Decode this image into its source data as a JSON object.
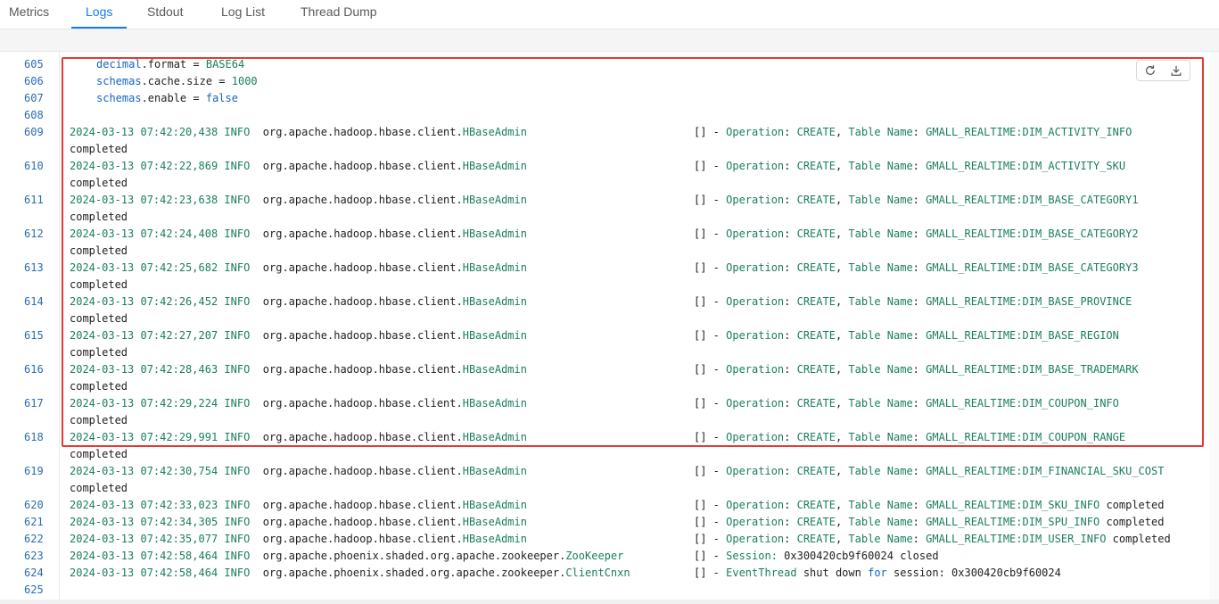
{
  "tabs": [
    {
      "label": "Metrics"
    },
    {
      "label": "Logs"
    },
    {
      "label": "Stdout"
    },
    {
      "label": "Log List"
    },
    {
      "label": "Thread Dump"
    }
  ],
  "toolbar": {
    "refresh_icon": "refresh-icon",
    "download_icon": "download-icon"
  },
  "colors": {
    "accent": "#1677ff",
    "highlight_border": "#e53935",
    "log_green": "#1a7f5a",
    "line_number": "#2b6cb0"
  },
  "config_lines": [
    {
      "num": "605",
      "obj": "decimal",
      "prop": ".format",
      "eq": " = ",
      "val": "BASE64"
    },
    {
      "num": "606",
      "obj": "schemas",
      "prop": ".cache.size",
      "eq": " = ",
      "val": "1000"
    },
    {
      "num": "607",
      "obj": "schemas",
      "prop": ".enable",
      "eq": " = ",
      "val": "false"
    }
  ],
  "blank_line": "608",
  "log_lines": [
    {
      "num": "609",
      "ts": "2024-03-13 07:42:20,438",
      "level": "INFO",
      "pkg": "org.apache.hadoop.hbase.client.",
      "cls": "HBaseAdmin",
      "table": "GMALL_REALTIME:DIM_ACTIVITY_INFO",
      "tail": "completed"
    },
    {
      "num": "610",
      "ts": "2024-03-13 07:42:22,869",
      "level": "INFO",
      "pkg": "org.apache.hadoop.hbase.client.",
      "cls": "HBaseAdmin",
      "table": "GMALL_REALTIME:DIM_ACTIVITY_SKU",
      "tail": "completed"
    },
    {
      "num": "611",
      "ts": "2024-03-13 07:42:23,638",
      "level": "INFO",
      "pkg": "org.apache.hadoop.hbase.client.",
      "cls": "HBaseAdmin",
      "table": "GMALL_REALTIME:DIM_BASE_CATEGORY1",
      "tail": "completed"
    },
    {
      "num": "612",
      "ts": "2024-03-13 07:42:24,408",
      "level": "INFO",
      "pkg": "org.apache.hadoop.hbase.client.",
      "cls": "HBaseAdmin",
      "table": "GMALL_REALTIME:DIM_BASE_CATEGORY2",
      "tail": "completed"
    },
    {
      "num": "613",
      "ts": "2024-03-13 07:42:25,682",
      "level": "INFO",
      "pkg": "org.apache.hadoop.hbase.client.",
      "cls": "HBaseAdmin",
      "table": "GMALL_REALTIME:DIM_BASE_CATEGORY3",
      "tail": "completed"
    },
    {
      "num": "614",
      "ts": "2024-03-13 07:42:26,452",
      "level": "INFO",
      "pkg": "org.apache.hadoop.hbase.client.",
      "cls": "HBaseAdmin",
      "table": "GMALL_REALTIME:DIM_BASE_PROVINCE",
      "tail": "completed"
    },
    {
      "num": "615",
      "ts": "2024-03-13 07:42:27,207",
      "level": "INFO",
      "pkg": "org.apache.hadoop.hbase.client.",
      "cls": "HBaseAdmin",
      "table": "GMALL_REALTIME:DIM_BASE_REGION",
      "tail": "completed"
    },
    {
      "num": "616",
      "ts": "2024-03-13 07:42:28,463",
      "level": "INFO",
      "pkg": "org.apache.hadoop.hbase.client.",
      "cls": "HBaseAdmin",
      "table": "GMALL_REALTIME:DIM_BASE_TRADEMARK",
      "tail": "completed"
    },
    {
      "num": "617",
      "ts": "2024-03-13 07:42:29,224",
      "level": "INFO",
      "pkg": "org.apache.hadoop.hbase.client.",
      "cls": "HBaseAdmin",
      "table": "GMALL_REALTIME:DIM_COUPON_INFO",
      "tail": "completed"
    },
    {
      "num": "618",
      "ts": "2024-03-13 07:42:29,991",
      "level": "INFO",
      "pkg": "org.apache.hadoop.hbase.client.",
      "cls": "HBaseAdmin",
      "table": "GMALL_REALTIME:DIM_COUPON_RANGE",
      "tail": "completed"
    },
    {
      "num": "619",
      "ts": "2024-03-13 07:42:30,754",
      "level": "INFO",
      "pkg": "org.apache.hadoop.hbase.client.",
      "cls": "HBaseAdmin",
      "table": "GMALL_REALTIME:DIM_FINANCIAL_SKU_COST",
      "tail": "completed"
    }
  ],
  "log_inline": [
    {
      "num": "620",
      "ts": "2024-03-13 07:42:33,023",
      "level": "INFO",
      "pkg": "org.apache.hadoop.hbase.client.",
      "cls": "HBaseAdmin",
      "table": "GMALL_REALTIME:DIM_SKU_INFO",
      "tail": "completed"
    },
    {
      "num": "621",
      "ts": "2024-03-13 07:42:34,305",
      "level": "INFO",
      "pkg": "org.apache.hadoop.hbase.client.",
      "cls": "HBaseAdmin",
      "table": "GMALL_REALTIME:DIM_SPU_INFO",
      "tail": "completed"
    },
    {
      "num": "622",
      "ts": "2024-03-13 07:42:35,077",
      "level": "INFO",
      "pkg": "org.apache.hadoop.hbase.client.",
      "cls": "HBaseAdmin",
      "table": "GMALL_REALTIME:DIM_USER_INFO",
      "tail": "completed"
    }
  ],
  "log_session": [
    {
      "num": "623",
      "ts": "2024-03-13 07:42:58,464",
      "level": "INFO",
      "pkg": "org.apache.phoenix.shaded.org.apache.zookeeper.",
      "cls": "ZooKeeper",
      "msg_a": "Session: ",
      "msg_b": "0x300420cb9f60024 closed",
      "msg_c": ""
    },
    {
      "num": "624",
      "ts": "2024-03-13 07:42:58,464",
      "level": "INFO",
      "pkg": "org.apache.phoenix.shaded.org.apache.zookeeper.",
      "cls": "ClientCnxn",
      "msg_a": "EventThread",
      "msg_b": " shut down ",
      "msg_c": "for",
      "msg_d": " session: 0x300420cb9f60024"
    }
  ],
  "last_line": "625",
  "msg": {
    "bracket": "[] - ",
    "operation": "Operation",
    "colon": ": ",
    "create": "CREATE",
    "comma": ", ",
    "table": "Table",
    "name": " Name",
    "colon2": ": "
  }
}
